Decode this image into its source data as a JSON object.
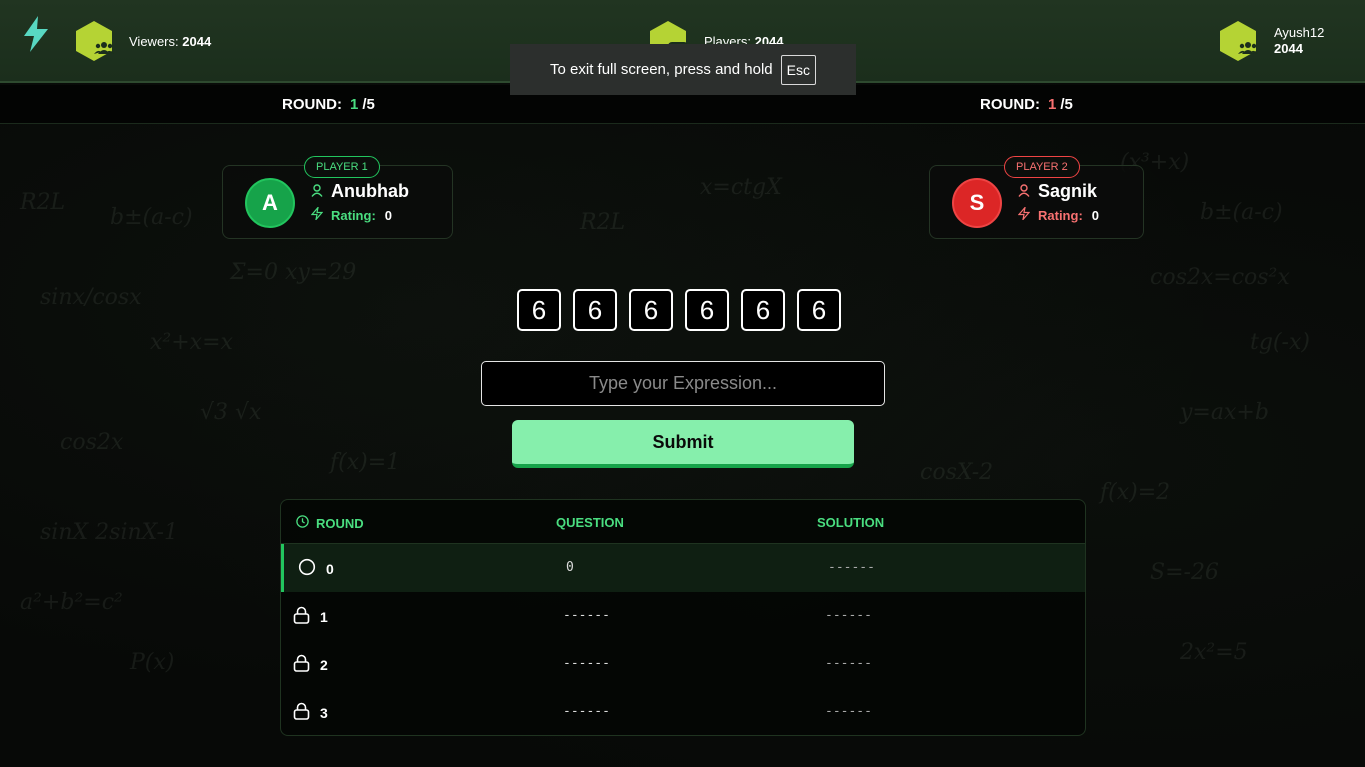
{
  "header": {
    "viewers_label": "Viewers:",
    "viewers_count": "2044",
    "players_label": "Players:",
    "players_count": "2044",
    "username": "Ayush12",
    "user_score": "2044",
    "colors": {
      "accent": "#b5d334",
      "header_bg": "#213521"
    }
  },
  "toast": {
    "message": "To exit full screen, press and hold",
    "key": "Esc"
  },
  "rounds": {
    "left": {
      "label": "ROUND:",
      "current": "1",
      "total": "/5"
    },
    "right": {
      "label": "ROUND:",
      "current": "1",
      "total": "/5"
    }
  },
  "player1": {
    "tag": "PLAYER 1",
    "initial": "A",
    "name": "Anubhab",
    "rating_label": "Rating:",
    "rating": "0",
    "color": "#22c55e"
  },
  "player2": {
    "tag": "PLAYER 2",
    "initial": "S",
    "name": "Sagnik",
    "rating_label": "Rating:",
    "rating": "0",
    "color": "#ef4444"
  },
  "digits": [
    "6",
    "6",
    "6",
    "6",
    "6",
    "6"
  ],
  "expression": {
    "value": "",
    "placeholder": "Type your Expression..."
  },
  "submit_label": "Submit",
  "table": {
    "headers": {
      "round": "ROUND",
      "question": "QUESTION",
      "solution": "SOLUTION"
    },
    "rows": [
      {
        "round": "0",
        "question": "0",
        "solution": "------",
        "status": "active",
        "icon": "circle-icon"
      },
      {
        "round": "1",
        "question": "------",
        "solution": "------",
        "status": "locked",
        "icon": "lock-icon"
      },
      {
        "round": "2",
        "question": "------",
        "solution": "------",
        "status": "locked",
        "icon": "lock-icon"
      },
      {
        "round": "3",
        "question": "------",
        "solution": "------",
        "status": "locked",
        "icon": "lock-icon"
      }
    ]
  }
}
